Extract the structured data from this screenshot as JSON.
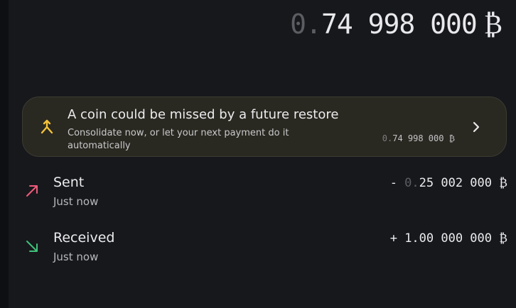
{
  "balance": {
    "dim_part": "0.",
    "main_part": "74 998 000",
    "symbol": "₿"
  },
  "banner": {
    "title": "A coin could be missed by a future restore",
    "subtitle": "Consolidate now, or let your next payment do it automatically",
    "amount_dim": "0.",
    "amount_main": "74 998 000 ₿",
    "icon": "consolidate-icon",
    "accent": "#f5c23a"
  },
  "transactions": [
    {
      "label": "Sent",
      "time": "Just now",
      "sign": "- ",
      "amount_dim": "0.",
      "amount_main": "25 002 000 ₿",
      "icon": "arrow-up-right-icon",
      "color": "#ef5b7b"
    },
    {
      "label": "Received",
      "time": "Just now",
      "sign": "+ ",
      "amount_dim": "",
      "amount_main": "1.00 000 000 ₿",
      "icon": "arrow-down-right-icon",
      "color": "#3fc17a"
    }
  ]
}
